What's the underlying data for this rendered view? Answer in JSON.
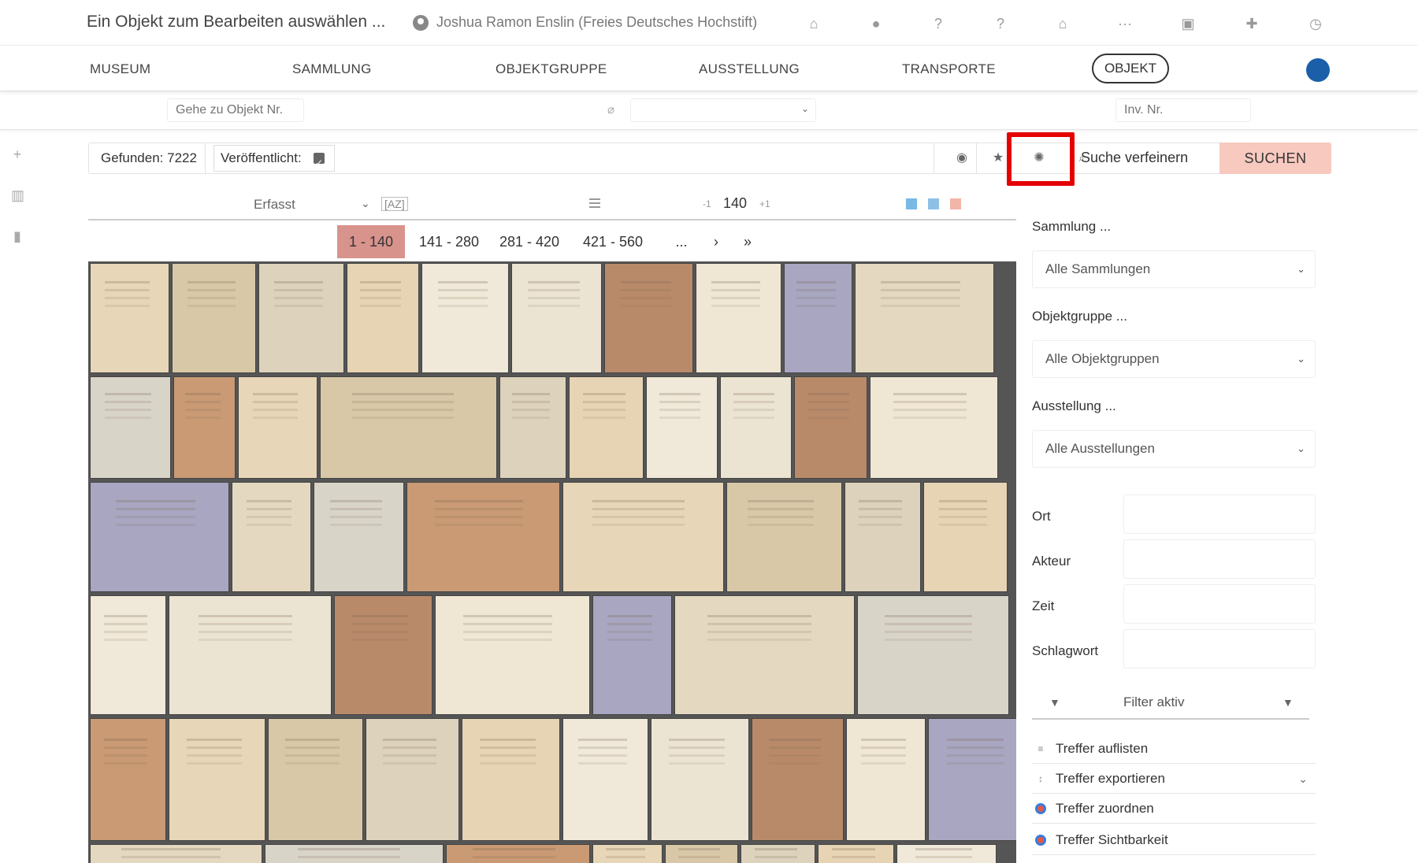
{
  "header": {
    "title": "Ein Objekt zum Bearbeiten auswählen ...",
    "user": "Joshua Ramon Enslin (Freies Deutsches Hochstift)",
    "icons": [
      "home-icon",
      "bell-icon",
      "help-icon",
      "help-circle-icon",
      "institution-icon",
      "more-icon",
      "chart-icon",
      "puzzle-icon",
      "clock-icon"
    ]
  },
  "nav": {
    "museum": "MUSEUM",
    "sammlung": "SAMMLUNG",
    "objektgruppe": "OBJEKTGRUPPE",
    "ausstellung": "AUSSTELLUNG",
    "transporte": "TRANSPORTE",
    "objekt": "OBJEKT"
  },
  "searchbar": {
    "goto_placeholder": "Gehe zu Objekt Nr.",
    "inv_placeholder": "Inv. Nr.",
    "select_value": ""
  },
  "toolbar": {
    "found": "Gefunden: 7222",
    "published": "Veröffentlicht:",
    "refine": "Suche verfeinern",
    "search": "SUCHEN"
  },
  "sort": {
    "field": "Erfasst",
    "az": "[AZ]",
    "minus": "-1",
    "per_page": "140",
    "plus": "+1",
    "view_colors": [
      "#7ab8e6",
      "#8ec0e6",
      "#f2b6a8"
    ]
  },
  "pager": {
    "pages": [
      "1 - 140",
      "141 - 280",
      "281 - 420",
      "421 - 560",
      "...",
      "›",
      "»"
    ],
    "active_index": 0
  },
  "panel": {
    "sammlung_label": "Sammlung ...",
    "sammlung_value": "Alle Sammlungen",
    "objektgruppe_label": "Objektgruppe ...",
    "objektgruppe_value": "Alle Objektgruppen",
    "ausstellung_label": "Ausstellung ...",
    "ausstellung_value": "Alle Ausstellungen",
    "ort": "Ort",
    "akteur": "Akteur",
    "zeit": "Zeit",
    "schlagwort": "Schlagwort",
    "filter": "Filter aktiv",
    "auflisten": "Treffer auflisten",
    "exportieren": "Treffer exportieren",
    "zuordnen": "Treffer zuordnen",
    "sichtbarkeit": "Treffer Sichtbarkeit"
  },
  "colors": {
    "search_button": "#f7c9bf",
    "active_page": "#d8938d",
    "highlight": "#e50000",
    "accent_dot": "#1a5fa8"
  }
}
